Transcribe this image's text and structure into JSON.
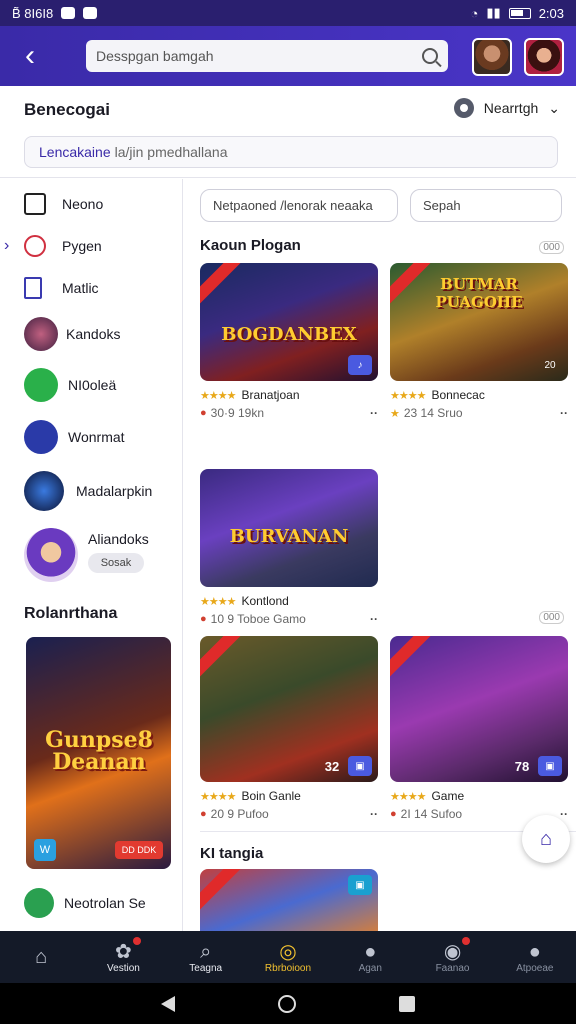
{
  "status_bar": {
    "left_text": "B̃ 8I6I8",
    "time": "2:03"
  },
  "header": {
    "back_label": "‹",
    "search_placeholder": "Desspgan bamgah"
  },
  "subheader": {
    "title": "Benecogai",
    "sort_label": "Nearrtgh",
    "filter_prefix": "Lencakaine",
    "filter_text": "la/jin pmedhallana"
  },
  "sidebar": {
    "items": [
      {
        "label": "Neono",
        "icon": "news-icon"
      },
      {
        "label": "Pygen",
        "icon": "check-circle-icon"
      },
      {
        "label": "Matlic",
        "icon": "document-icon"
      },
      {
        "label": "Kandoks",
        "icon": "game-avatar-icon"
      },
      {
        "label": "NI0oleä",
        "icon": "calendar-icon"
      },
      {
        "label": "Wonrmat",
        "icon": "store-icon"
      },
      {
        "label": "Madalarpkin",
        "icon": "game-logo-icon"
      },
      {
        "label": "Aliandoks",
        "icon": "character-avatar-icon",
        "pill": "Sosak"
      }
    ],
    "section_title": "Rolanrthana",
    "promo": {
      "title": "Gunpse8 Deanan",
      "badge": "DD DDK",
      "tag": "W"
    },
    "footer_item": {
      "label": "Neotrolan Se"
    }
  },
  "main": {
    "chips": [
      "Netpaoned /lenorak neaaka",
      "Sepah"
    ],
    "section1": {
      "title": "Kaoun Plogan",
      "more": "000"
    },
    "cards": [
      {
        "logo": "BOGDANBEX",
        "title": "Branatjoan",
        "meta": "30·9  19kn",
        "stars": "★★★★",
        "corner": "♪"
      },
      {
        "logo": "BUTMAR PUAGOHE",
        "title": "Bonnecac",
        "meta": "23 14  Sruo",
        "stars": "★★★★",
        "corner": "20"
      },
      {
        "logo": "BURVANAN",
        "title": "Kontlond",
        "meta": "10 9  Toboe  Gamo",
        "stars": "★★★★",
        "corner": ""
      },
      {
        "logo": "",
        "title": "Boin Ganle",
        "meta": "20 9  Pufoo",
        "stars": "★★★★",
        "corner": "▣",
        "corner_left": "32"
      },
      {
        "logo": "",
        "title": "Game",
        "meta": "2I 14  Sufoo",
        "stars": "★★★★",
        "corner": "▣",
        "corner_left": "78"
      }
    ],
    "more2": "000",
    "section2": {
      "title": "KI tangia"
    }
  },
  "bottom_nav": [
    {
      "label": "",
      "icon": "home-icon"
    },
    {
      "label": "Vestion",
      "icon": "puzzle-icon",
      "badge": true
    },
    {
      "label": "Teagna",
      "icon": "search-icon"
    },
    {
      "label": "Rbrboioon",
      "icon": "compass-icon",
      "active": true
    },
    {
      "label": "Agan",
      "icon": "user-icon"
    },
    {
      "label": "Faanao",
      "icon": "chat-icon",
      "badge": true
    },
    {
      "label": "Atpoeae",
      "icon": "profile-icon"
    }
  ],
  "colors": {
    "header": "#3a2aa8",
    "accent": "#3a2aa8",
    "nav_bg": "#141a28",
    "active": "#f0c030",
    "star": "#e8a81a"
  }
}
